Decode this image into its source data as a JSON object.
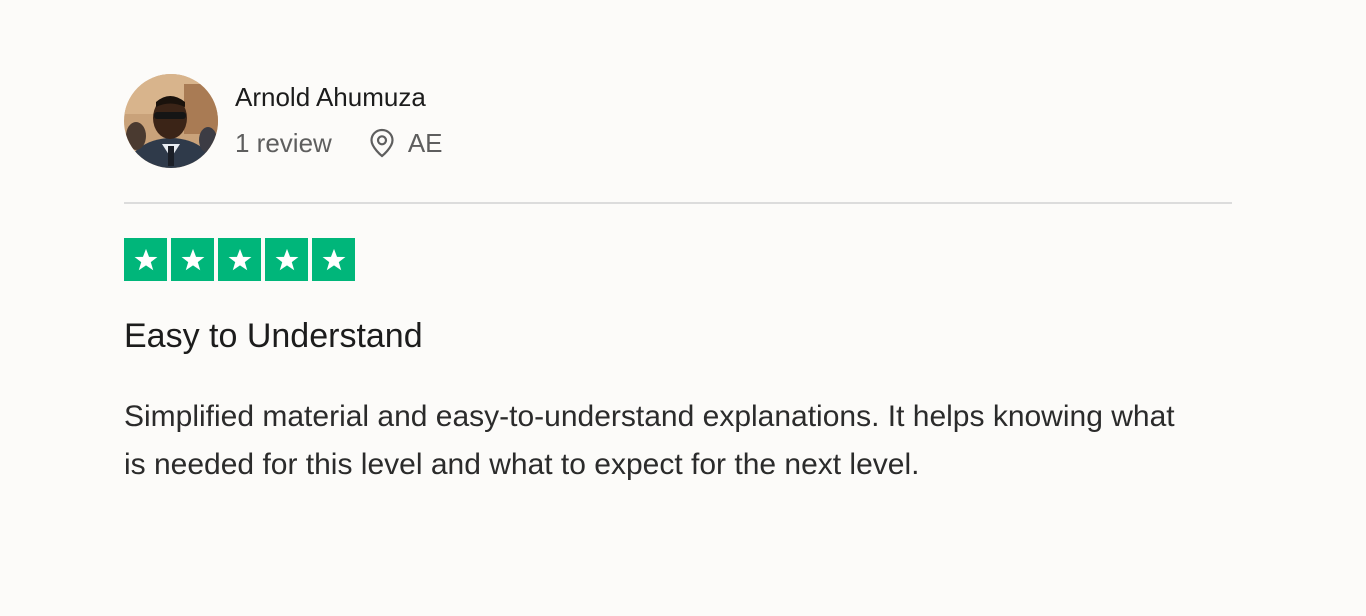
{
  "consumer": {
    "name": "Arnold Ahumuza",
    "review_count": "1 review",
    "location": "AE",
    "avatar_icon": "user-avatar-photo"
  },
  "rating": {
    "stars": 5,
    "max": 5,
    "color": "#00b67a"
  },
  "review": {
    "title": "Easy to Understand",
    "body": "Simplified material and easy-to-understand explanations. It helps knowing what is needed for this level and what to expect for the next level."
  },
  "icons": {
    "location": "location-pin-icon",
    "star": "star-icon"
  }
}
